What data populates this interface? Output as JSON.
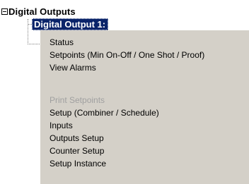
{
  "tree": {
    "root_label": "Digital Outputs",
    "selected_label": "Digital Output 1:"
  },
  "menu": {
    "items": [
      {
        "label": "Status",
        "enabled": true
      },
      {
        "label": "Setpoints (Min On-Off / One Shot / Proof)",
        "enabled": true
      },
      {
        "label": "View Alarms",
        "enabled": true
      },
      {
        "label": "Print Setpoints",
        "enabled": false
      },
      {
        "label": "Setup (Combiner / Schedule)",
        "enabled": true
      },
      {
        "label": "Inputs",
        "enabled": true
      },
      {
        "label": "Outputs Setup",
        "enabled": true
      },
      {
        "label": "Counter Setup",
        "enabled": true
      },
      {
        "label": "Setup Instance",
        "enabled": true
      }
    ]
  },
  "colors": {
    "selection": "#0a246a",
    "menu_bg": "#d4d0c8",
    "disabled_text": "#a0a0a0"
  }
}
